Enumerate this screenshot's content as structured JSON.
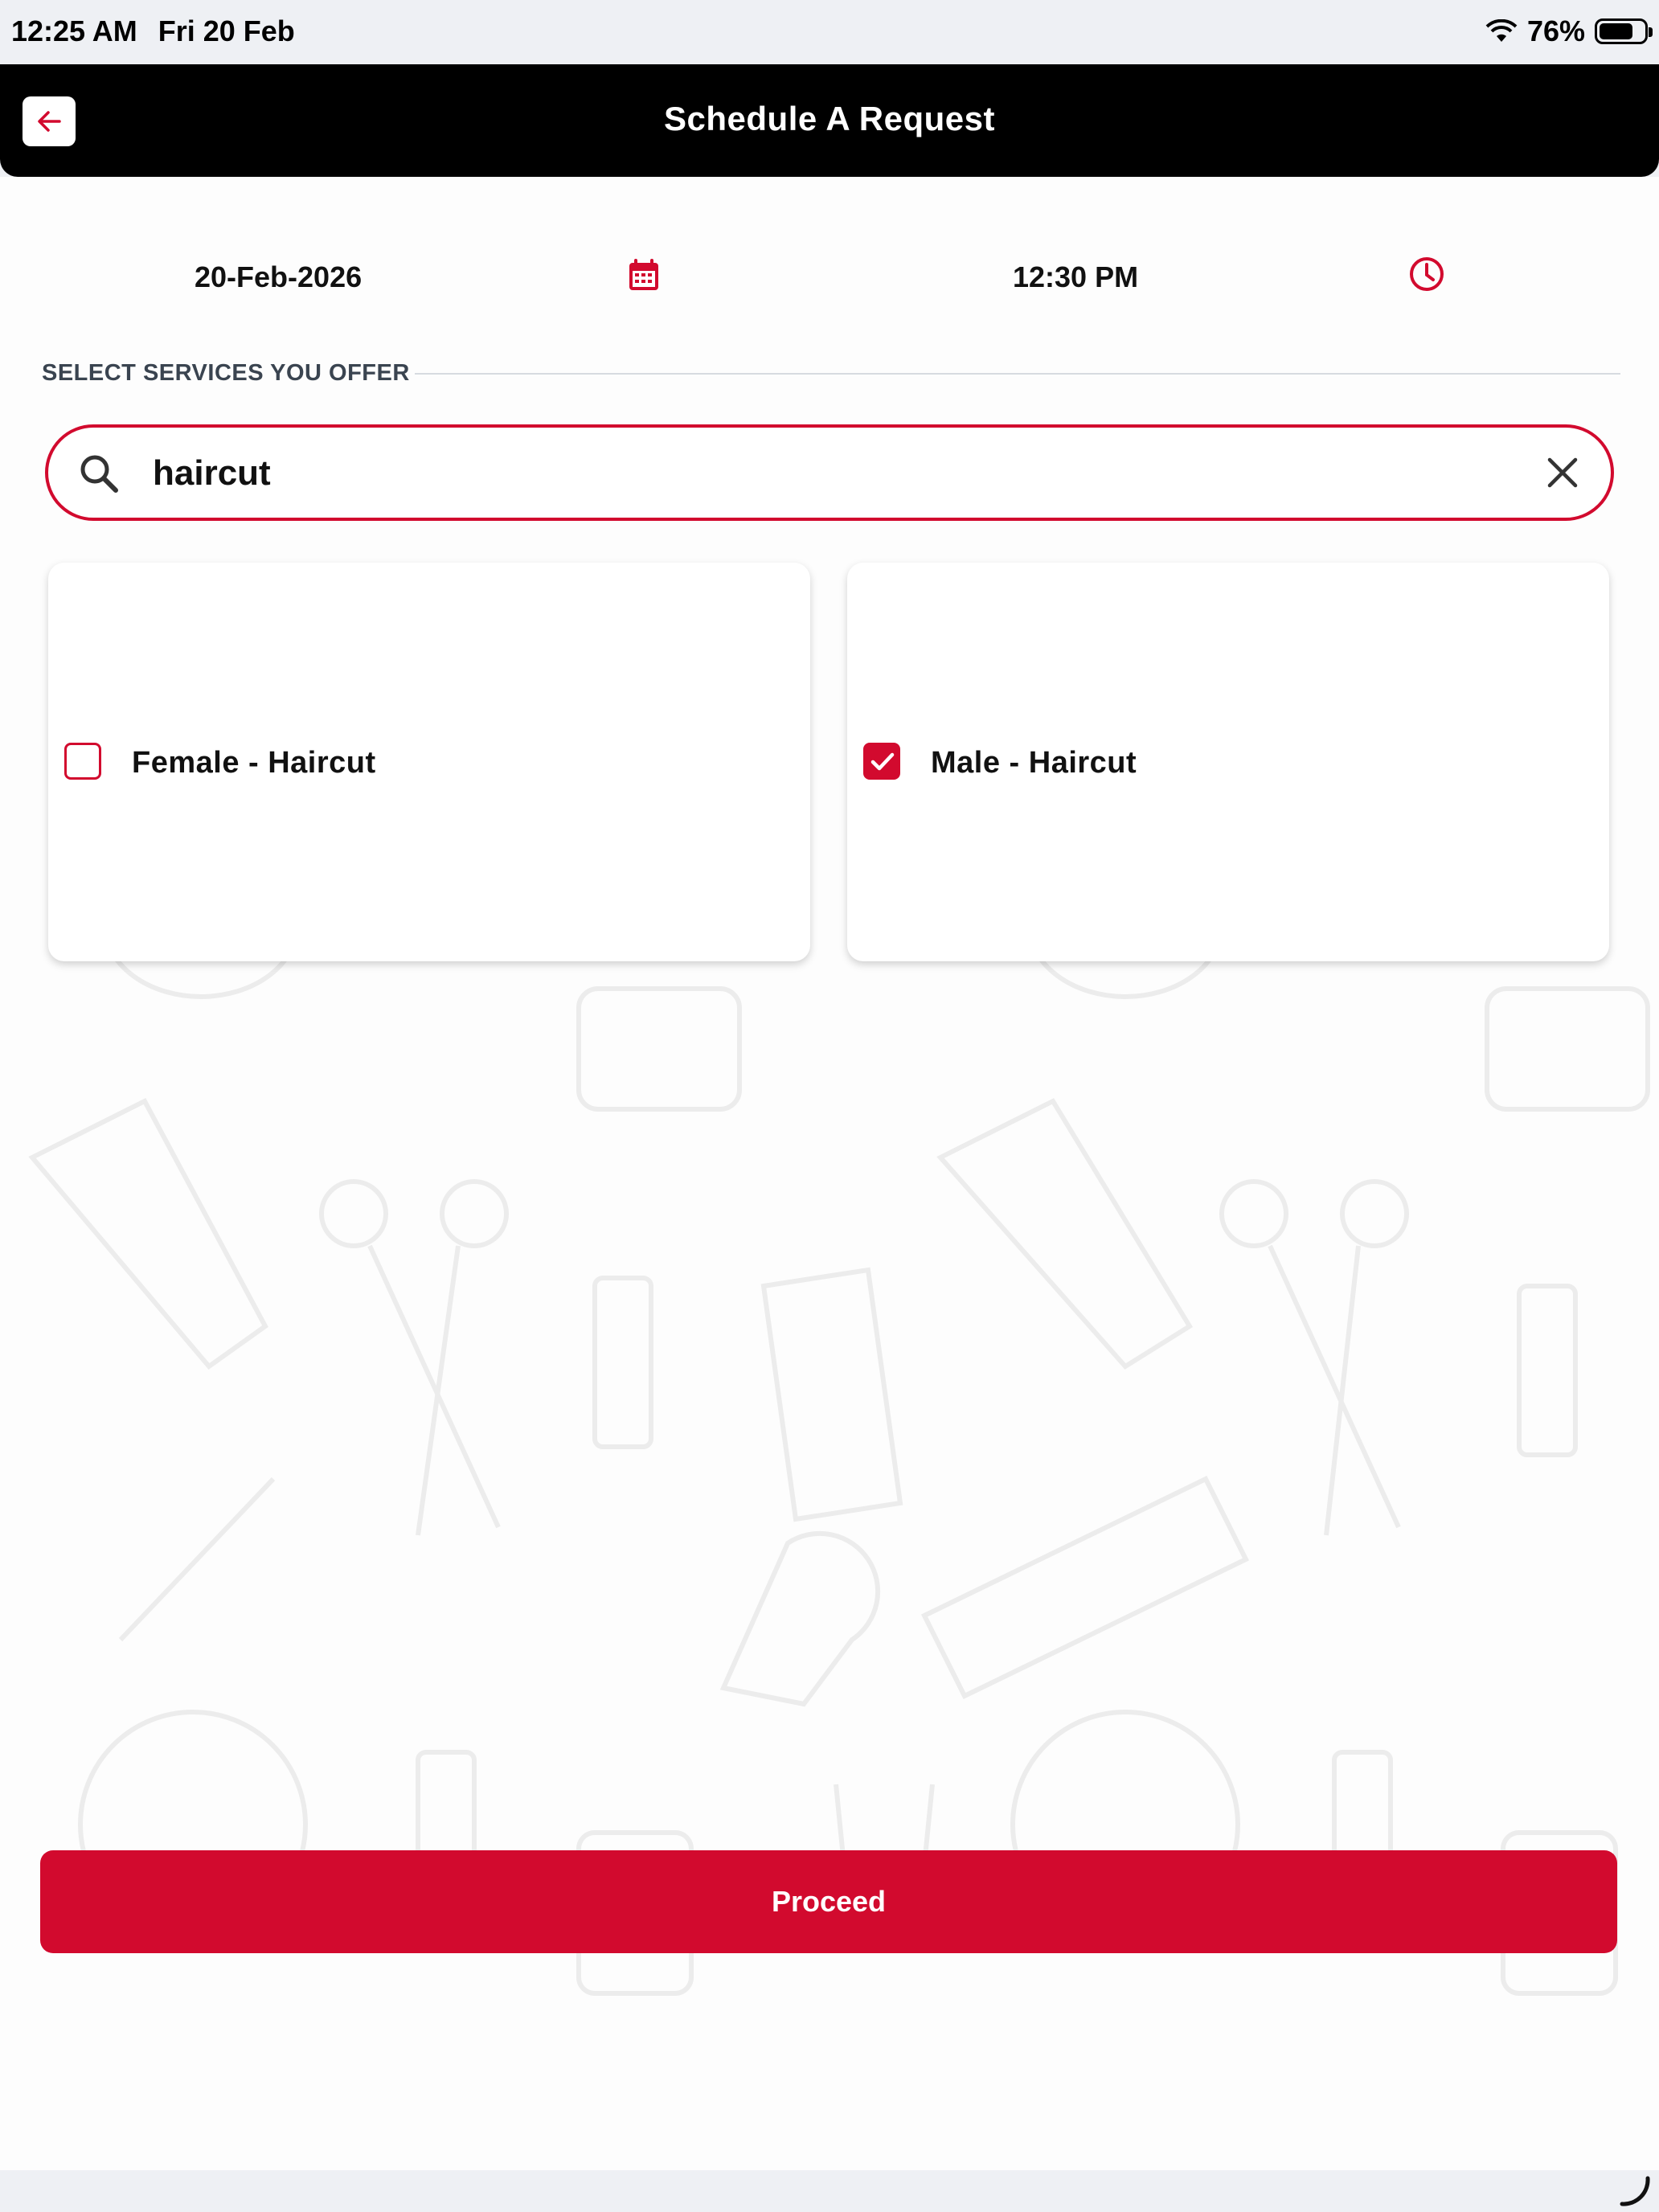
{
  "status_bar": {
    "time": "12:25 AM",
    "date": "Fri 20 Feb",
    "battery": "76%",
    "battery_level": 0.76,
    "icons": [
      "wifi-icon",
      "battery-icon"
    ]
  },
  "header": {
    "title": "Schedule A Request",
    "back_icon": "arrow-left-icon"
  },
  "schedule": {
    "date": "20-Feb-2026",
    "date_icon": "calendar-icon",
    "time": "12:30 PM",
    "time_icon": "clock-icon"
  },
  "services": {
    "section_label": "SELECT SERVICES YOU OFFER",
    "search": {
      "value": "haircut",
      "search_icon": "search-icon",
      "clear_icon": "close-icon"
    },
    "items": [
      {
        "label": "Female - Haircut",
        "checked": false
      },
      {
        "label": "Male - Haircut",
        "checked": true
      }
    ]
  },
  "actions": {
    "proceed_label": "Proceed"
  },
  "colors": {
    "accent": "#d20a2e",
    "header_bg": "#000000",
    "background": "#fdfdfd"
  }
}
